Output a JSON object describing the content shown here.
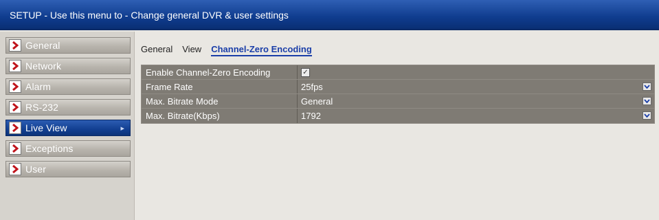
{
  "window": {
    "title": "SETUP - Use this menu to - Change general DVR & user settings"
  },
  "sidebar": {
    "items": [
      {
        "label": "General",
        "active": false
      },
      {
        "label": "Network",
        "active": false
      },
      {
        "label": "Alarm",
        "active": false
      },
      {
        "label": "RS-232",
        "active": false
      },
      {
        "label": "Live View",
        "active": true
      },
      {
        "label": "Exceptions",
        "active": false
      },
      {
        "label": "User",
        "active": false
      }
    ]
  },
  "tabs": [
    {
      "label": "General",
      "selected": false
    },
    {
      "label": "View",
      "selected": false
    },
    {
      "label": "Channel-Zero Encoding",
      "selected": true
    }
  ],
  "settings": [
    {
      "label": "Enable Channel-Zero Encoding",
      "type": "checkbox",
      "checked": true
    },
    {
      "label": "Frame Rate",
      "type": "select",
      "value": "25fps"
    },
    {
      "label": "Max. Bitrate Mode",
      "type": "select",
      "value": "General"
    },
    {
      "label": "Max. Bitrate(Kbps)",
      "type": "select",
      "value": "1792"
    }
  ],
  "colors": {
    "title_bar": "#0f3c8e",
    "active_item": "#123f91",
    "grid_cell": "#7f7b74",
    "chevron": "#c0141b"
  },
  "icons": {
    "sidebar_item": "chevron-right-icon",
    "dropdown": "chevron-down-icon",
    "checkbox": "checkmark-icon"
  }
}
